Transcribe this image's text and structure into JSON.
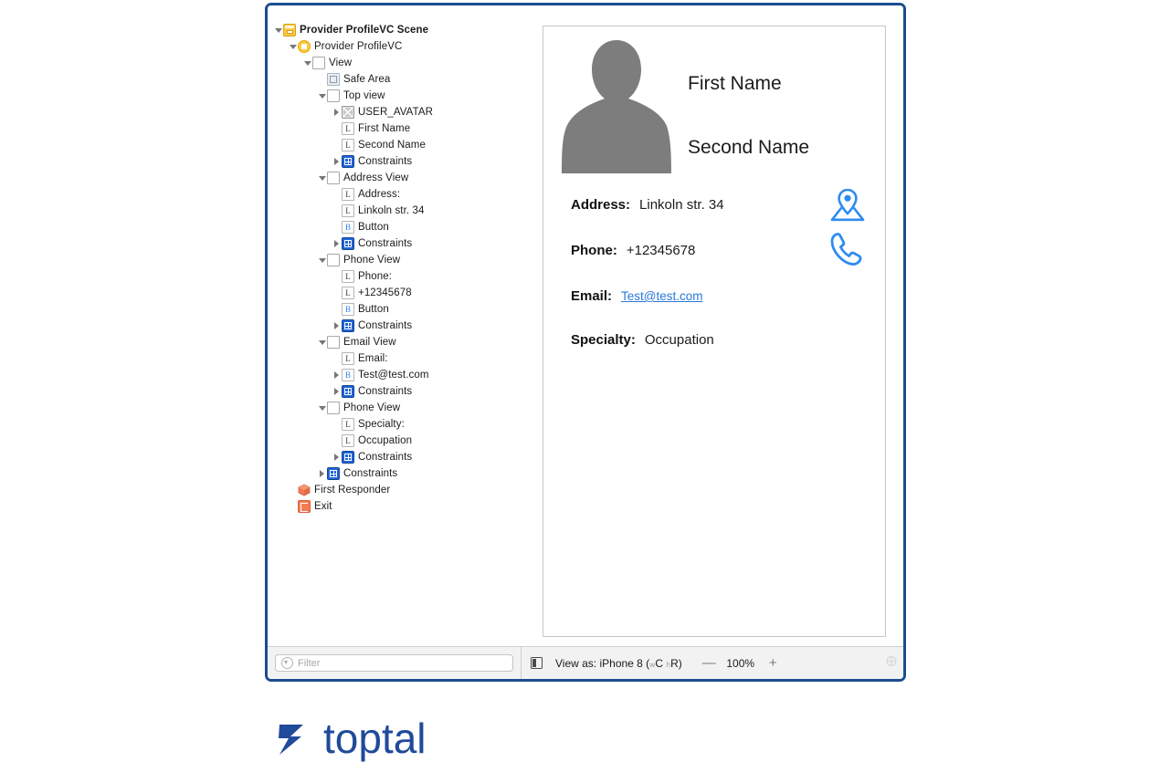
{
  "window": {
    "accent_border": "#1a4d8f",
    "background": "#ffffff"
  },
  "outline": {
    "rows": [
      {
        "label": "Provider ProfileVC Scene",
        "indent": 0,
        "twisty": "open",
        "icon": "scene-icon",
        "bold": true,
        "icon_text": ""
      },
      {
        "label": "Provider ProfileVC",
        "indent": 1,
        "twisty": "open",
        "icon": "view-controller-icon",
        "bold": false,
        "icon_text": ""
      },
      {
        "label": "View",
        "indent": 2,
        "twisty": "open",
        "icon": "view-icon",
        "bold": false,
        "icon_text": ""
      },
      {
        "label": "Safe Area",
        "indent": 3,
        "twisty": "none",
        "icon": "safe-area-icon",
        "bold": false,
        "icon_text": ""
      },
      {
        "label": "Top view",
        "indent": 3,
        "twisty": "open",
        "icon": "view-icon",
        "bold": false,
        "icon_text": ""
      },
      {
        "label": "USER_AVATAR",
        "indent": 4,
        "twisty": "closed",
        "icon": "image-view-icon",
        "bold": false,
        "icon_text": ""
      },
      {
        "label": "First Name",
        "indent": 4,
        "twisty": "none",
        "icon": "label-icon",
        "bold": false,
        "icon_text": "L"
      },
      {
        "label": "Second Name",
        "indent": 4,
        "twisty": "none",
        "icon": "label-icon",
        "bold": false,
        "icon_text": "L"
      },
      {
        "label": "Constraints",
        "indent": 4,
        "twisty": "closed",
        "icon": "constraints-icon",
        "bold": false,
        "icon_text": ""
      },
      {
        "label": "Address View",
        "indent": 3,
        "twisty": "open",
        "icon": "view-icon",
        "bold": false,
        "icon_text": ""
      },
      {
        "label": "Address:",
        "indent": 4,
        "twisty": "none",
        "icon": "label-icon",
        "bold": false,
        "icon_text": "L"
      },
      {
        "label": "Linkoln str. 34",
        "indent": 4,
        "twisty": "none",
        "icon": "label-icon",
        "bold": false,
        "icon_text": "L"
      },
      {
        "label": "Button",
        "indent": 4,
        "twisty": "none",
        "icon": "button-icon",
        "bold": false,
        "icon_text": "B"
      },
      {
        "label": "Constraints",
        "indent": 4,
        "twisty": "closed",
        "icon": "constraints-icon",
        "bold": false,
        "icon_text": ""
      },
      {
        "label": "Phone View",
        "indent": 3,
        "twisty": "open",
        "icon": "view-icon",
        "bold": false,
        "icon_text": ""
      },
      {
        "label": "Phone:",
        "indent": 4,
        "twisty": "none",
        "icon": "label-icon",
        "bold": false,
        "icon_text": "L"
      },
      {
        "label": "+12345678",
        "indent": 4,
        "twisty": "none",
        "icon": "label-icon",
        "bold": false,
        "icon_text": "L"
      },
      {
        "label": "Button",
        "indent": 4,
        "twisty": "none",
        "icon": "button-icon",
        "bold": false,
        "icon_text": "B"
      },
      {
        "label": "Constraints",
        "indent": 4,
        "twisty": "closed",
        "icon": "constraints-icon",
        "bold": false,
        "icon_text": ""
      },
      {
        "label": "Email View",
        "indent": 3,
        "twisty": "open",
        "icon": "view-icon",
        "bold": false,
        "icon_text": ""
      },
      {
        "label": "Email:",
        "indent": 4,
        "twisty": "none",
        "icon": "label-icon",
        "bold": false,
        "icon_text": "L"
      },
      {
        "label": "Test@test.com",
        "indent": 4,
        "twisty": "closed",
        "icon": "button-icon",
        "bold": false,
        "icon_text": "B"
      },
      {
        "label": "Constraints",
        "indent": 4,
        "twisty": "closed",
        "icon": "constraints-icon",
        "bold": false,
        "icon_text": ""
      },
      {
        "label": "Phone View",
        "indent": 3,
        "twisty": "open",
        "icon": "view-icon",
        "bold": false,
        "icon_text": ""
      },
      {
        "label": "Specialty:",
        "indent": 4,
        "twisty": "none",
        "icon": "label-icon",
        "bold": false,
        "icon_text": "L"
      },
      {
        "label": "Occupation",
        "indent": 4,
        "twisty": "none",
        "icon": "label-icon",
        "bold": false,
        "icon_text": "L"
      },
      {
        "label": "Constraints",
        "indent": 4,
        "twisty": "closed",
        "icon": "constraints-icon",
        "bold": false,
        "icon_text": ""
      },
      {
        "label": "Constraints",
        "indent": 3,
        "twisty": "closed",
        "icon": "constraints-icon",
        "bold": false,
        "icon_text": ""
      },
      {
        "label": "First Responder",
        "indent": 1,
        "twisty": "none",
        "icon": "first-responder-icon",
        "bold": false,
        "icon_text": ""
      },
      {
        "label": "Exit",
        "indent": 1,
        "twisty": "none",
        "icon": "exit-icon",
        "bold": false,
        "icon_text": ""
      }
    ]
  },
  "canvas": {
    "avatar_color": "#7d7d7d",
    "accent_icon_color": "#2d8cf0",
    "first_name": "First Name",
    "second_name": "Second Name",
    "rows": [
      {
        "key": "Address:",
        "value": "Linkoln str. 34"
      },
      {
        "key": "Phone:",
        "value": "+12345678"
      },
      {
        "key": "Email:",
        "value": "Test@test.com"
      },
      {
        "key": "Specialty:",
        "value": "Occupation"
      }
    ]
  },
  "toolbar": {
    "filter_placeholder": "Filter",
    "filter_value": "",
    "view_as_prefix": "View as: iPhone 8 (",
    "view_as_w": "w",
    "view_as_wclass": "C",
    "view_as_h": "h",
    "view_as_hclass": "R",
    "view_as_suffix": ")",
    "zoom_out": "—",
    "zoom_value": "100%",
    "zoom_in": "+"
  },
  "brand": {
    "name": "toptal",
    "color": "#204a9a"
  }
}
